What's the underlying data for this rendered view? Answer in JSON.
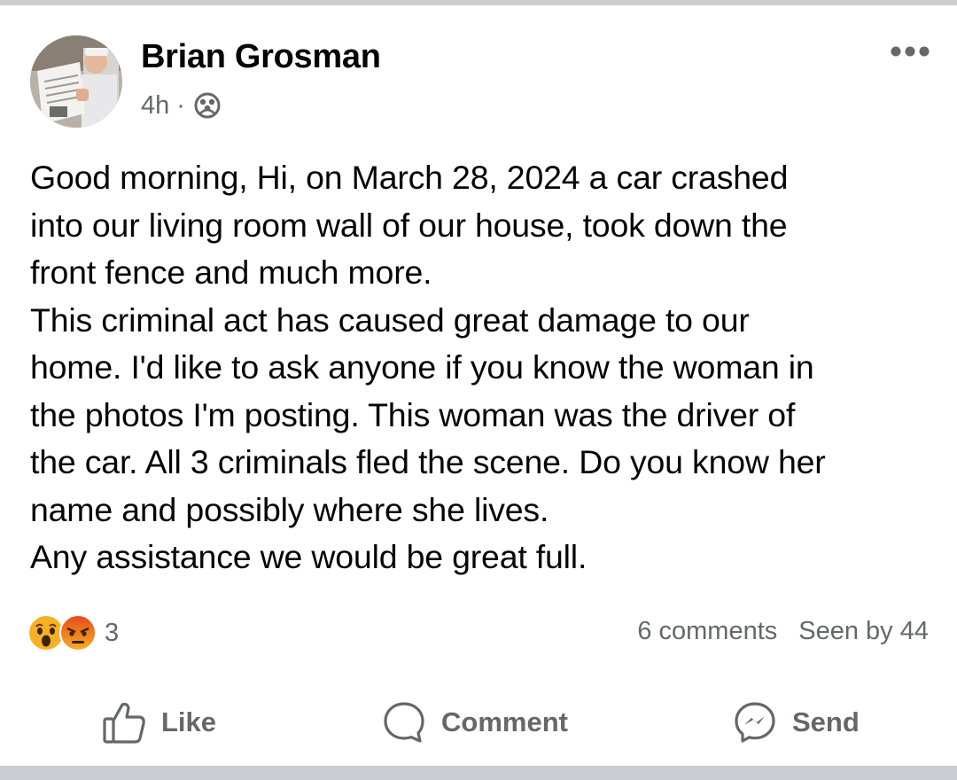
{
  "post": {
    "author": "Brian Grosman",
    "time": "4h",
    "separator": "·",
    "audience_icon": "group-icon",
    "body": "Good morning, Hi, on March 28, 2024 a car crashed\ninto our living room wall of our house, took down the\nfront fence and much more.\nThis criminal act has caused great damage to our\nhome. I'd like to ask anyone if you know the woman in\nthe photos I'm posting. This woman was the driver of\nthe car. All 3 criminals fled the scene. Do you know her\nname and possibly where she lives.\nAny assistance we would be great full.",
    "reactions": {
      "icons": [
        "wow-reaction-icon",
        "angry-reaction-icon"
      ],
      "count": "3"
    },
    "comments_label": "6 comments",
    "seen_label": "Seen by 44"
  },
  "actions": {
    "like": "Like",
    "comment": "Comment",
    "send": "Send"
  },
  "colors": {
    "secondary_text": "#65676b",
    "primary_text": "#050505",
    "divider": "#c9ccd1",
    "reaction_yellow": "#f7b125",
    "reaction_red": "#e9710f"
  }
}
